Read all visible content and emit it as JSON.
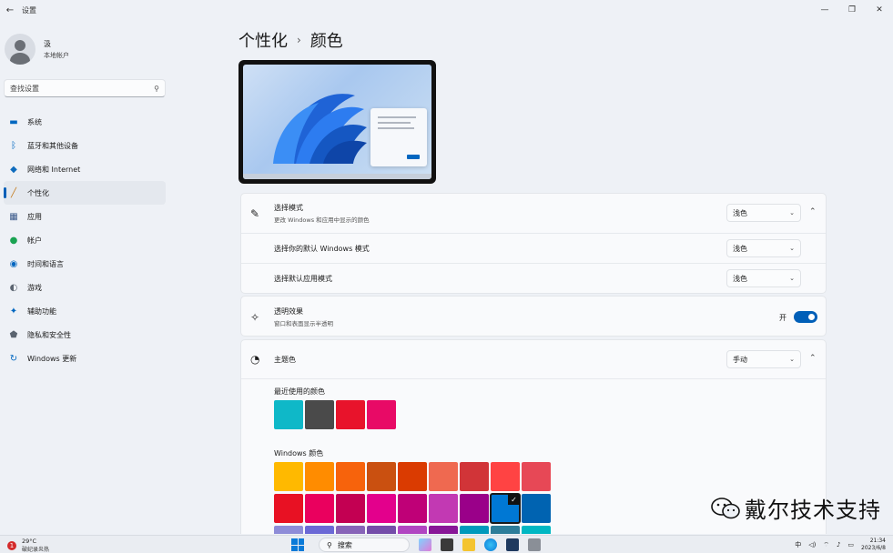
{
  "window": {
    "title": "设置",
    "back_glyph": "←",
    "controls": {
      "minimize": "—",
      "maximize": "❐",
      "close": "✕"
    }
  },
  "profile": {
    "name": "汲",
    "account_type": "本地帐户"
  },
  "search": {
    "placeholder": "查找设置"
  },
  "nav": [
    {
      "label": "系统",
      "icon": "monitor-icon",
      "color": "#0067c0",
      "active": false
    },
    {
      "label": "蓝牙和其他设备",
      "icon": "bluetooth-icon",
      "color": "#0067c0",
      "active": false
    },
    {
      "label": "网络和 Internet",
      "icon": "wifi-icon",
      "color": "#0f6cbd",
      "active": false
    },
    {
      "label": "个性化",
      "icon": "brush-icon",
      "color": "#c47a1b",
      "active": true
    },
    {
      "label": "应用",
      "icon": "apps-icon",
      "color": "#3b5a8a",
      "active": false
    },
    {
      "label": "帐户",
      "icon": "person-icon",
      "color": "#1aa352",
      "active": false
    },
    {
      "label": "时间和语言",
      "icon": "globe-clock-icon",
      "color": "#0067c0",
      "active": false
    },
    {
      "label": "游戏",
      "icon": "gamepad-icon",
      "color": "#5b6470",
      "active": false
    },
    {
      "label": "辅助功能",
      "icon": "accessibility-icon",
      "color": "#0067c0",
      "active": false
    },
    {
      "label": "隐私和安全性",
      "icon": "shield-icon",
      "color": "#5b6470",
      "active": false
    },
    {
      "label": "Windows 更新",
      "icon": "update-icon",
      "color": "#0067c0",
      "active": false
    }
  ],
  "breadcrumb": {
    "parent": "个性化",
    "separator": "›",
    "current": "颜色"
  },
  "mode": {
    "title": "选择模式",
    "subtitle": "更改 Windows 和应用中显示的颜色",
    "value": "浅色",
    "icon": "paintbrush-icon",
    "windows_mode_label": "选择你的默认 Windows 模式",
    "windows_mode_value": "浅色",
    "app_mode_label": "选择默认应用模式",
    "app_mode_value": "浅色"
  },
  "transparency": {
    "title": "透明效果",
    "subtitle": "窗口和表面显示半透明",
    "state_label": "开",
    "on": true,
    "icon": "sparkle-icon"
  },
  "accent": {
    "title": "主题色",
    "value": "手动",
    "icon": "palette-icon",
    "recent_label": "最近使用的颜色",
    "recent_colors": [
      "#0fb8c8",
      "#4a4a4a",
      "#e8132b",
      "#e80a66"
    ],
    "windows_label": "Windows 颜色",
    "windows_colors_row1": [
      "#ffb900",
      "#ff8c00",
      "#f7630c",
      "#ca5010",
      "#da3b01",
      "#ef6950",
      "#d13438",
      "#ff4343",
      "#e74856"
    ],
    "windows_colors_row2": [
      "#e81123",
      "#ea005e",
      "#c30052",
      "#e3008c",
      "#bf0077",
      "#c239b3",
      "#9a0089",
      "#0078d4",
      "#0063b1"
    ],
    "windows_colors_row3": [
      "#8e8cd8",
      "#6b69d6",
      "#8764b8",
      "#744da9",
      "#b146c2",
      "#881798",
      "#0099bc",
      "#2d7d9a",
      "#00b7c3"
    ],
    "selected_row2_index": 7,
    "check_glyph": "✓"
  },
  "watermark": {
    "text": "戴尔技术支持"
  },
  "taskbar": {
    "weather_temp": "29°C",
    "weather_desc": "破纪录炎热",
    "weather_badge": "1",
    "search_label": "搜索",
    "ime": "中",
    "time": "21:34",
    "date": "2023/6/8"
  }
}
